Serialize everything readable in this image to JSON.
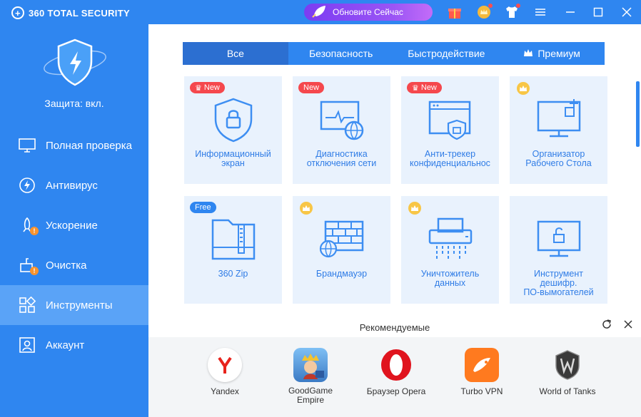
{
  "app": {
    "title": "360 TOTAL SECURITY"
  },
  "sidebar": {
    "status": "Защита: вкл.",
    "items": [
      {
        "label": "Полная проверка"
      },
      {
        "label": "Антивирус"
      },
      {
        "label": "Ускорение"
      },
      {
        "label": "Очистка"
      },
      {
        "label": "Инструменты"
      },
      {
        "label": "Аккаунт"
      }
    ]
  },
  "topbar": {
    "upgrade_label": "Обновите Сейчас"
  },
  "tabs": [
    {
      "label": "Все"
    },
    {
      "label": "Безопасность"
    },
    {
      "label": "Быстродействие"
    },
    {
      "label": "Премиум"
    }
  ],
  "tools": [
    {
      "label": "Информационный\nэкран",
      "badge": "New"
    },
    {
      "label": "Диагностика\nотключения сети",
      "badge": "New"
    },
    {
      "label": "Анти-трекер\nконфиденциальнос",
      "badge": "New"
    },
    {
      "label": "Организатор\nРабочего Стола",
      "badge": ""
    },
    {
      "label": "360 Zip",
      "badge": "Free"
    },
    {
      "label": "Брандмауэр",
      "badge": ""
    },
    {
      "label": "Уничтожитель\nданных",
      "badge": ""
    },
    {
      "label": "Инструмент\nдешифр.\nПО-вымогателей",
      "badge": ""
    }
  ],
  "recommended": {
    "title": "Рекомендуемые",
    "apps": [
      {
        "label": "Yandex"
      },
      {
        "label": "GoodGame\nEmpire"
      },
      {
        "label": "Браузер Opera"
      },
      {
        "label": "Turbo VPN"
      },
      {
        "label": "World of Tanks"
      }
    ]
  },
  "colors": {
    "accent": "#2f86f0",
    "active_nav": "#5aa3f7",
    "tile_bg": "#e9f2fd",
    "new_badge": "#f5484d",
    "premium_crown": "#f8c646"
  }
}
